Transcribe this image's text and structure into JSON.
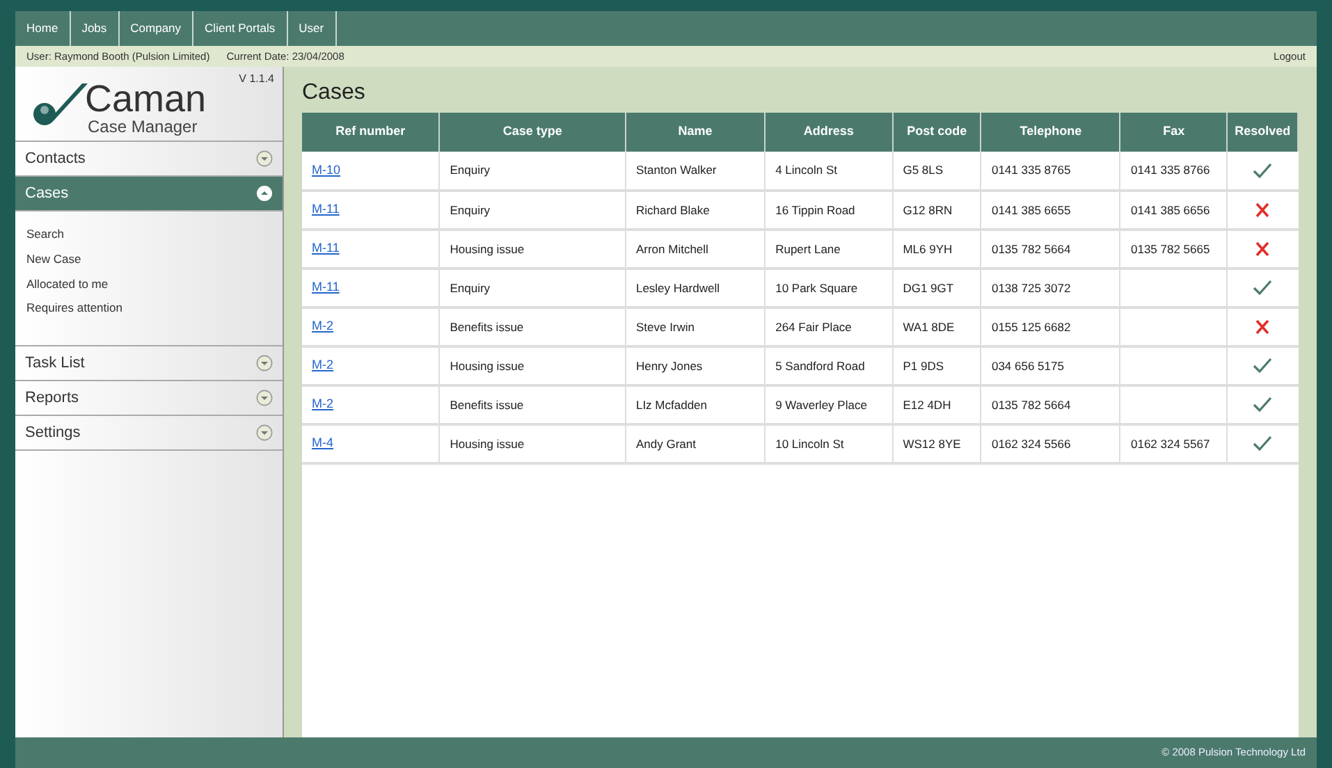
{
  "nav": {
    "items": [
      {
        "label": "Home"
      },
      {
        "label": "Jobs"
      },
      {
        "label": "Company"
      },
      {
        "label": "Client Portals"
      },
      {
        "label": "User"
      }
    ]
  },
  "info_bar": {
    "user": "User:  Raymond Booth (Pulsion Limited)",
    "date": "Current Date: 23/04/2008",
    "logout": "Logout"
  },
  "sidebar": {
    "logo": {
      "name": "Caman",
      "subtitle": "Case Manager"
    },
    "version": "V 1.1.4",
    "sections": [
      {
        "label": "Contacts",
        "expanded": false
      },
      {
        "label": "Cases",
        "expanded": true,
        "items": [
          "Search",
          "New Case",
          "Allocated to me",
          "Requires attention"
        ]
      },
      {
        "label": "Task List",
        "expanded": false
      },
      {
        "label": "Reports",
        "expanded": false
      },
      {
        "label": "Settings",
        "expanded": false
      }
    ]
  },
  "page_title": "Cases",
  "table": {
    "columns": [
      "Ref number",
      "Case type",
      "Name",
      "Address",
      "Post code",
      "Telephone",
      "Fax",
      "Resolved"
    ],
    "rows": [
      {
        "ref": "M-10",
        "case_type": "Enquiry",
        "name": "Stanton Walker",
        "address": "4 Lincoln St",
        "post_code": "G5 8LS",
        "telephone": "0141 335 8765",
        "fax": "0141 335 8766",
        "resolved": true
      },
      {
        "ref": "M-11",
        "case_type": "Enquiry",
        "name": "Richard Blake",
        "address": "16 Tippin Road",
        "post_code": "G12 8RN",
        "telephone": "0141 385 6655",
        "fax": "0141 385 6656",
        "resolved": false
      },
      {
        "ref": "M-11",
        "case_type": "Housing issue",
        "name": "Arron Mitchell",
        "address": "Rupert Lane",
        "post_code": "ML6 9YH",
        "telephone": "0135 782 5664",
        "fax": "0135 782 5665",
        "resolved": false
      },
      {
        "ref": "M-11",
        "case_type": "Enquiry",
        "name": "Lesley Hardwell",
        "address": "10 Park Square",
        "post_code": "DG1 9GT",
        "telephone": "0138 725 3072",
        "resolved": true
      },
      {
        "ref": "M-2",
        "case_type": "Benefits issue",
        "name": "Steve Irwin",
        "address": "264 Fair Place",
        "post_code": "WA1 8DE",
        "telephone": "0155 125 6682",
        "resolved": false
      },
      {
        "ref": "M-2",
        "case_type": "Housing issue",
        "name": "Henry Jones",
        "address": "5 Sandford Road",
        "post_code": "P1 9DS",
        "telephone": "034 656 5175",
        "resolved": true
      },
      {
        "ref": "M-2",
        "case_type": "Benefits issue",
        "name": "LIz Mcfadden",
        "address": "9 Waverley Place",
        "post_code": "E12 4DH",
        "telephone": "0135 782 5664",
        "resolved": true
      },
      {
        "ref": "M-4",
        "case_type": "Housing issue",
        "name": "Andy Grant",
        "address": "10 Lincoln St",
        "post_code": "WS12 8YE",
        "telephone": "0162 324 5566",
        "fax": "0162 324 5567",
        "resolved": true
      }
    ]
  },
  "footer": "© 2008 Pulsion Technology Ltd"
}
